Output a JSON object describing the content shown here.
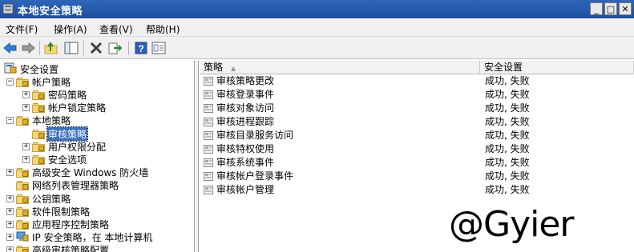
{
  "window": {
    "title": "本地安全策略"
  },
  "window_buttons": {
    "minimize": "_",
    "maximize": "□",
    "close": "✕"
  },
  "menu": [
    "文件(F)",
    "操作(A)",
    "查看(V)",
    "帮助(H)"
  ],
  "toolbar": {
    "icons": [
      "back-arrow-icon",
      "forward-arrow-icon",
      "up-folder-icon",
      "show-hide-tree-icon",
      "delete-icon",
      "export-list-icon",
      "help-icon",
      "properties-icon"
    ]
  },
  "tree": [
    {
      "label": "安全设置",
      "level": 0,
      "expander": "",
      "icon": "security-settings-icon"
    },
    {
      "label": "帐户策略",
      "level": 1,
      "expander": "−",
      "icon": "folder-icon"
    },
    {
      "label": "密码策略",
      "level": 2,
      "expander": "+",
      "icon": "folder-icon"
    },
    {
      "label": "帐户锁定策略",
      "level": 2,
      "expander": "+",
      "icon": "folder-icon"
    },
    {
      "label": "本地策略",
      "level": 1,
      "expander": "−",
      "icon": "folder-icon"
    },
    {
      "label": "审核策略",
      "level": 2,
      "expander": "",
      "icon": "folder-icon",
      "selected": true
    },
    {
      "label": "用户权限分配",
      "level": 2,
      "expander": "+",
      "icon": "folder-icon"
    },
    {
      "label": "安全选项",
      "level": 2,
      "expander": "+",
      "icon": "folder-icon"
    },
    {
      "label": "高级安全 Windows 防火墙",
      "level": 1,
      "expander": "+",
      "icon": "firewall-icon"
    },
    {
      "label": "网络列表管理器策略",
      "level": 1,
      "expander": "",
      "icon": "folder-icon"
    },
    {
      "label": "公钥策略",
      "level": 1,
      "expander": "+",
      "icon": "folder-icon"
    },
    {
      "label": "软件限制策略",
      "level": 1,
      "expander": "+",
      "icon": "folder-icon"
    },
    {
      "label": "应用程序控制策略",
      "level": 1,
      "expander": "+",
      "icon": "folder-icon"
    },
    {
      "label": "IP 安全策略，在 本地计算机",
      "level": 1,
      "expander": "+",
      "icon": "ip-security-icon"
    },
    {
      "label": "高级审核策略配置",
      "level": 1,
      "expander": "+",
      "icon": "folder-icon"
    }
  ],
  "list": {
    "columns": [
      "策略",
      "安全设置"
    ],
    "sort_indicator": "▲",
    "rows": [
      {
        "policy": "审核策略更改",
        "setting": "成功, 失败"
      },
      {
        "policy": "审核登录事件",
        "setting": "成功, 失败"
      },
      {
        "policy": "审核对象访问",
        "setting": "成功, 失败"
      },
      {
        "policy": "审核进程跟踪",
        "setting": "成功, 失败"
      },
      {
        "policy": "审核目录服务访问",
        "setting": "成功, 失败"
      },
      {
        "policy": "审核特权使用",
        "setting": "成功, 失败"
      },
      {
        "policy": "审核系统事件",
        "setting": "成功, 失败"
      },
      {
        "policy": "审核帐户登录事件",
        "setting": "成功, 失败"
      },
      {
        "policy": "审核帐户管理",
        "setting": "成功, 失败"
      }
    ]
  },
  "watermark": "@Gyier",
  "colors": {
    "title_bar": "#2f66b8",
    "selection": "#3a6fc4",
    "folder": "#f6d776"
  }
}
